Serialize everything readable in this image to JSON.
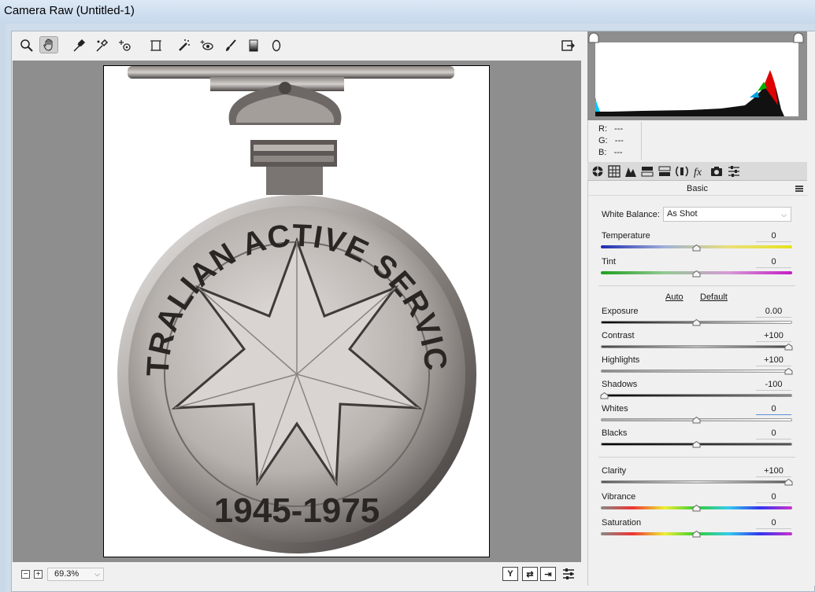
{
  "window": {
    "title": "Camera Raw (Untitled-1)"
  },
  "toolbar": {
    "tools": [
      {
        "name": "zoom-tool-icon"
      },
      {
        "name": "hand-tool-icon",
        "active": true
      },
      {
        "name": "white-balance-tool-icon"
      },
      {
        "name": "color-sampler-tool-icon"
      },
      {
        "name": "targeted-adjustment-tool-icon"
      },
      {
        "name": "transform-tool-icon"
      },
      {
        "name": "spot-removal-tool-icon"
      },
      {
        "name": "red-eye-removal-icon"
      },
      {
        "name": "adjustment-brush-icon"
      },
      {
        "name": "graduated-filter-icon"
      },
      {
        "name": "radial-filter-icon"
      }
    ],
    "open_preferences_icon": "export-icon"
  },
  "image": {
    "title_text": "THE AUSTRALIAN ACTIVE SERVICE MEDAL",
    "years_text": "1945-1975"
  },
  "bottom": {
    "zoom_out": "−",
    "zoom_in": "+",
    "zoom_value": "69.3%",
    "y_button": "Y"
  },
  "histogram": {
    "rgb": {
      "r_label": "R:",
      "r_val": "---",
      "g_label": "G:",
      "g_val": "---",
      "b_label": "B:",
      "b_val": "---"
    }
  },
  "panel": {
    "title": "Basic",
    "white_balance_label": "White Balance:",
    "white_balance_value": "As Shot",
    "auto": "Auto",
    "default": "Default",
    "sliders": [
      {
        "id": "temperature",
        "label": "Temperature",
        "value": "0",
        "position": 0.5
      },
      {
        "id": "tint",
        "label": "Tint",
        "value": "0",
        "position": 0.5
      },
      {
        "id": "exposure",
        "label": "Exposure",
        "value": "0.00",
        "position": 0.5
      },
      {
        "id": "contrast",
        "label": "Contrast",
        "value": "+100",
        "position": 1.0
      },
      {
        "id": "highlights",
        "label": "Highlights",
        "value": "+100",
        "position": 1.0
      },
      {
        "id": "shadows",
        "label": "Shadows",
        "value": "-100",
        "position": 0.0
      },
      {
        "id": "whites",
        "label": "Whites",
        "value": "0",
        "position": 0.5
      },
      {
        "id": "blacks",
        "label": "Blacks",
        "value": "0",
        "position": 0.5
      },
      {
        "id": "clarity",
        "label": "Clarity",
        "value": "+100",
        "position": 1.0
      },
      {
        "id": "vibrance",
        "label": "Vibrance",
        "value": "0",
        "position": 0.5
      },
      {
        "id": "saturation",
        "label": "Saturation",
        "value": "0",
        "position": 0.5
      }
    ]
  },
  "colors": {
    "canvas": "#8e8e8e",
    "panel": "#f0f0f0",
    "titlebar": "#c9d9ea"
  }
}
